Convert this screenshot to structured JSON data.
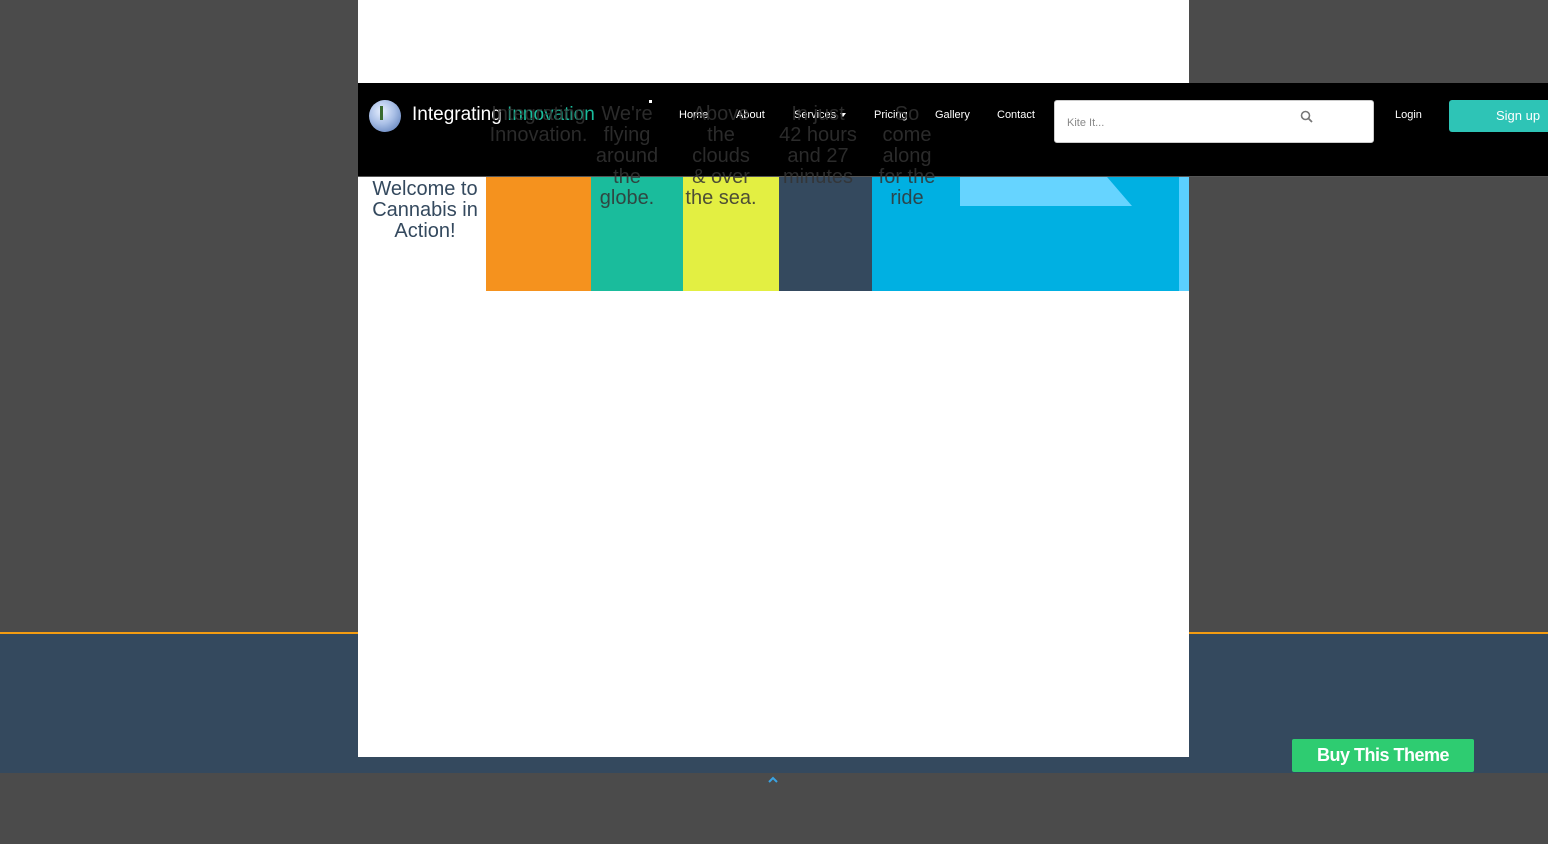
{
  "brand": {
    "name_part1": "Integrating ",
    "name_part2": "Innovation"
  },
  "nav": {
    "items": [
      {
        "label": "Home"
      },
      {
        "label": "About"
      },
      {
        "label": "Services"
      },
      {
        "label": "Pricing"
      },
      {
        "label": "Gallery"
      },
      {
        "label": "Contact"
      }
    ]
  },
  "search": {
    "placeholder": "Kite It...",
    "icon": "search-icon"
  },
  "auth": {
    "login_label": "Login",
    "signup_label": "Sign up"
  },
  "hero": {
    "welcome": "Welcome to Cannabis in Action!",
    "blocks": [
      {
        "text": "Integrating Innovation.",
        "color": "#f5921e"
      },
      {
        "text": "We're flying around the globe.",
        "color": "#1abc9c"
      },
      {
        "text": "Above the clouds & over the sea.",
        "color": "#e3ef42"
      },
      {
        "text": "In just 42 hours and 27 minutes",
        "color": "#34495e"
      },
      {
        "text": "So come along for the ride",
        "color": "#00b0e2"
      }
    ]
  },
  "footer": {
    "buy_label": "Buy This Theme"
  },
  "colors": {
    "background": "#4b4b4b",
    "footer_band": "#34495e",
    "accent_teal": "#2ec4b6",
    "buy_green": "#2ecc71"
  }
}
